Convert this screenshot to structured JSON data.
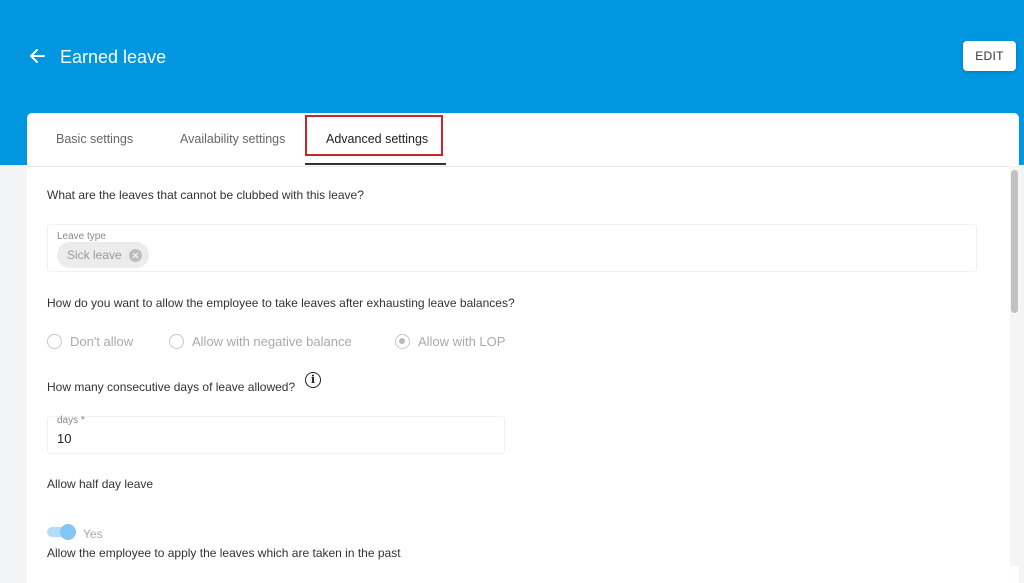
{
  "header": {
    "title": "Earned leave",
    "edit_label": "EDIT",
    "background_color": "#0096e0"
  },
  "tabs": [
    {
      "label": "Basic settings",
      "active": false
    },
    {
      "label": "Availability settings",
      "active": false
    },
    {
      "label": "Advanced settings",
      "active": true
    }
  ],
  "clubbing": {
    "question": "What are the leaves that cannot be clubbed with this leave?",
    "field_label": "Leave type",
    "chips": [
      "Sick leave"
    ]
  },
  "exhausting": {
    "question": "How do you want to allow the employee to take leaves after exhausting leave balances?",
    "options": [
      {
        "label": "Don't allow",
        "checked": false
      },
      {
        "label": "Allow with negative balance",
        "checked": false
      },
      {
        "label": "Allow with LOP",
        "checked": true
      }
    ]
  },
  "consecutive": {
    "question": "How many consecutive days of leave allowed?",
    "field_label": "days *",
    "value": "10"
  },
  "half_day": {
    "question": "Allow half day leave",
    "toggle_label": "Yes",
    "enabled": true
  },
  "past_leaves": {
    "question": "Allow the employee to apply the leaves which are taken in the past"
  },
  "highlight_color": "#d0222b"
}
